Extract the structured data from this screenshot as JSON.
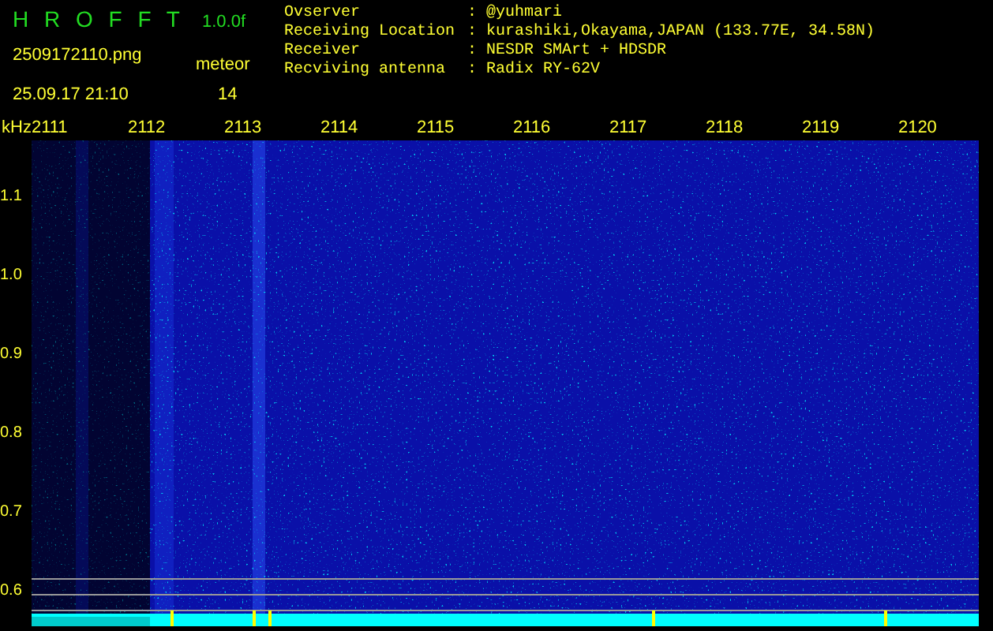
{
  "header": {
    "app_title": "H R O F F T",
    "version": "1.0.0f",
    "filename": "2509172110.png",
    "timestamp": "25.09.17 21:10",
    "meteor_label": "meteor",
    "meteor_count": "14"
  },
  "station_info": [
    {
      "label": "Ovserver",
      "separator": ":",
      "value": "@yuhmari"
    },
    {
      "label": "Receiving Location",
      "separator": ":",
      "value": "kurashiki,Okayama,JAPAN (133.77E, 34.58N)"
    },
    {
      "label": "Receiver",
      "separator": ":",
      "value": "NESDR SMArt + HDSDR"
    },
    {
      "label": "Recviving antenna",
      "separator": ":",
      "value": "Radix RY-62V"
    }
  ],
  "frequency_axis": {
    "unit": "kHz",
    "labels": [
      "2111",
      "2112",
      "2113",
      "2114",
      "2115",
      "2116",
      "2117",
      "2118",
      "2119",
      "2120"
    ]
  },
  "amplitude_axis": {
    "labels": [
      "1.1",
      "1.0",
      "0.9",
      "0.8",
      "0.7",
      "0.6"
    ]
  }
}
